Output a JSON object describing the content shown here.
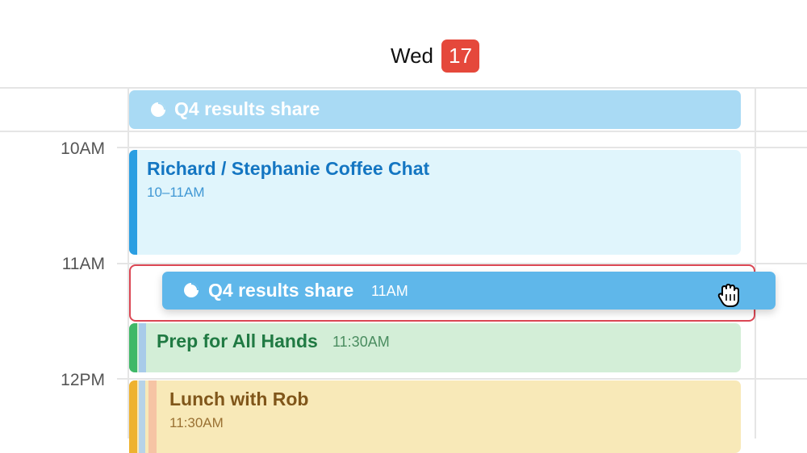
{
  "header": {
    "day_name": "Wed",
    "day_number": "17"
  },
  "time_labels": [
    "10AM",
    "11AM",
    "12PM"
  ],
  "all_day_event": {
    "title": "Q4 results share",
    "icon": "pie-chart-icon"
  },
  "events": {
    "coffee": {
      "title": "Richard / Stephanie Coffee Chat",
      "time": "10–11AM"
    },
    "dragging": {
      "title": "Q4 results share",
      "time": "11AM",
      "icon": "pie-chart-icon",
      "cursor": "grab-hand-icon"
    },
    "prep": {
      "title": "Prep for All Hands",
      "time": "11:30AM"
    },
    "lunch": {
      "title": "Lunch with Rob",
      "time": "11:30AM"
    }
  },
  "colors": {
    "badge": "#e5483b",
    "drop_target": "#db4754",
    "dragging": "#5fb7ea"
  }
}
